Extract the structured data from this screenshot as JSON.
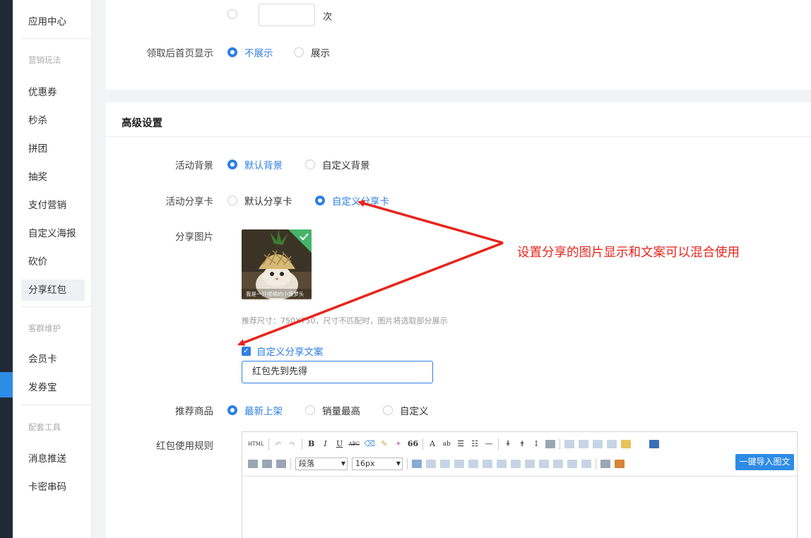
{
  "sidebar": {
    "items": [
      {
        "label": "应用中心",
        "type": "item"
      },
      {
        "label": "营销玩法",
        "type": "head"
      },
      {
        "label": "优惠券",
        "type": "item"
      },
      {
        "label": "秒杀",
        "type": "item"
      },
      {
        "label": "拼团",
        "type": "item"
      },
      {
        "label": "抽奖",
        "type": "item"
      },
      {
        "label": "支付营销",
        "type": "item"
      },
      {
        "label": "自定义海报",
        "type": "item"
      },
      {
        "label": "砍价",
        "type": "item"
      },
      {
        "label": "分享红包",
        "type": "item",
        "active": true
      },
      {
        "label": "客群维护",
        "type": "head"
      },
      {
        "label": "会员卡",
        "type": "item"
      },
      {
        "label": "发券宝",
        "type": "item"
      },
      {
        "label": "配套工具",
        "type": "head"
      },
      {
        "label": "消息推送",
        "type": "item"
      },
      {
        "label": "卡密串码",
        "type": "item"
      }
    ]
  },
  "top_section": {
    "times_unit": "次",
    "home_display": {
      "label": "领取后首页显示",
      "options": [
        "不展示",
        "展示"
      ],
      "selected": "不展示"
    }
  },
  "advanced": {
    "title": "高级设置",
    "background": {
      "label": "活动背景",
      "options": [
        "默认背景",
        "自定义背景"
      ],
      "selected": "默认背景"
    },
    "share_card": {
      "label": "活动分享卡",
      "options": [
        "默认分享卡",
        "自定义分享卡"
      ],
      "selected": "自定义分享卡"
    },
    "share_image": {
      "label": "分享图片",
      "hint": "推荐尺寸：750X750，尺寸不匹配时，图片将选取部分展示",
      "image_caption": "我是一只很萌的小菠萝头"
    },
    "custom_copy": {
      "checkbox_label": "自定义分享文案",
      "checked": true,
      "value": "红包先到先得"
    },
    "recommend": {
      "label": "推荐商品",
      "options": [
        "最新上架",
        "销量最高",
        "自定义"
      ],
      "selected": "最新上架"
    },
    "rules": {
      "label": "红包使用规则",
      "toolbar": {
        "html": "HTML",
        "bold": "B",
        "italic": "I",
        "underline": "U",
        "strike": "ABC",
        "quote": "66",
        "font_color": "A",
        "paragraph": "段落",
        "font_size": "16px",
        "import_button": "一键导入图文"
      }
    }
  },
  "annotation": {
    "text": "设置分享的图片显示和文案可以混合使用",
    "color": "#e8241c"
  },
  "colors": {
    "accent": "#2f7fe3",
    "sidebar_dark": "#1f2a36"
  }
}
